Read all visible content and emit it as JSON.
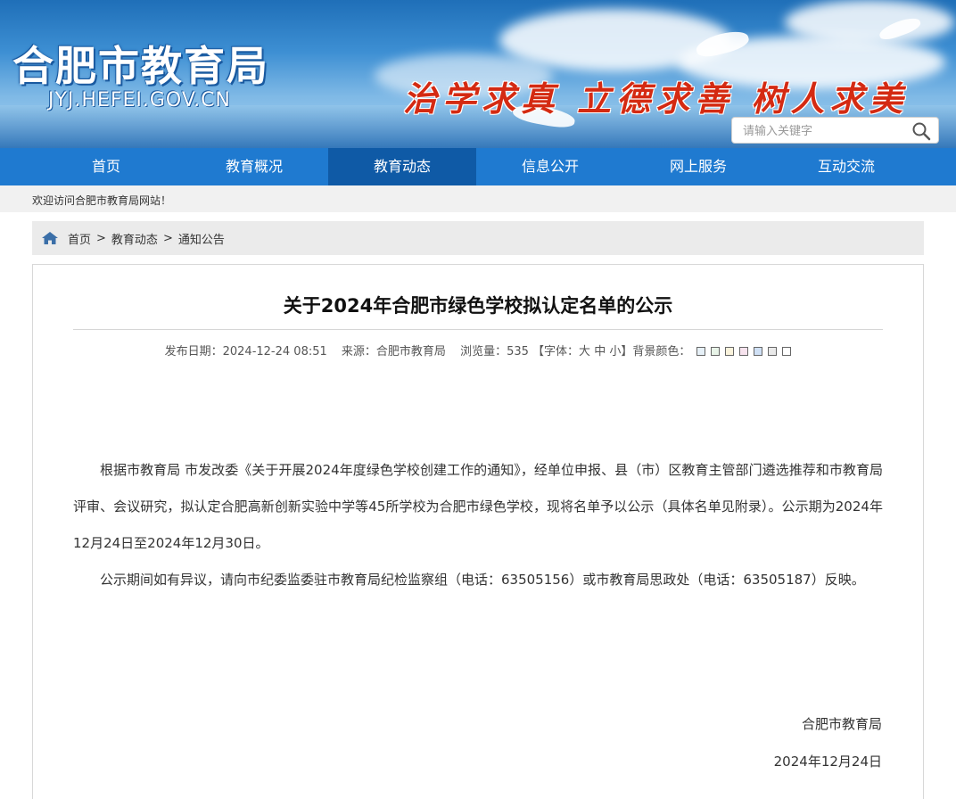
{
  "header": {
    "site_title": "合肥市教育局",
    "site_domain": "JYJ.HEFEI.GOV.CN",
    "slogan": "治学求真  立德求善  树人求美",
    "search_placeholder": "请输入关键字"
  },
  "nav": {
    "items": [
      "首页",
      "教育概况",
      "教育动态",
      "信息公开",
      "网上服务",
      "互动交流"
    ],
    "active": "教育动态"
  },
  "welcome": "欢迎访问合肥市教育局网站！",
  "breadcrumb": [
    "首页",
    "教育动态",
    "通知公告"
  ],
  "breadcrumb_sep": ">",
  "article": {
    "title": "关于2024年合肥市绿色学校拟认定名单的公示",
    "publish_label": "发布日期：2024-12-24 08:51",
    "source_label": "来源：合肥市教育局",
    "views_label": "浏览量：535",
    "font_prefix": "【字体：",
    "font_large": "大",
    "font_medium": "中",
    "font_small": "小",
    "font_suffix": "】背景颜色：",
    "bg_colors": [
      "#e6f0f7",
      "#e8f4e8",
      "#faf3dc",
      "#f7e3ee",
      "#cfe0f5",
      "#e9e9e9",
      "#ffffff"
    ],
    "paragraph1": "根据市教育局 市发改委《关于开展2024年度绿色学校创建工作的通知》，经单位申报、县（市）区教育主管部门遴选推荐和市教育局评审、会议研究，拟认定合肥高新创新实验中学等45所学校为合肥市绿色学校，现将名单予以公示（具体名单见附录）。公示期为2024年12月24日至2024年12月30日。",
    "paragraph2": "公示期间如有异议，请向市纪委监委驻市教育局纪检监察组（电话：63505156）或市教育局思政处（电话：63505187）反映。",
    "signature": "合肥市教育局",
    "date": "2024年12月24日"
  },
  "colors": {
    "nav_bg": "#1f7ad0",
    "nav_active": "#0f5aa6",
    "slogan": "#d42a12"
  }
}
